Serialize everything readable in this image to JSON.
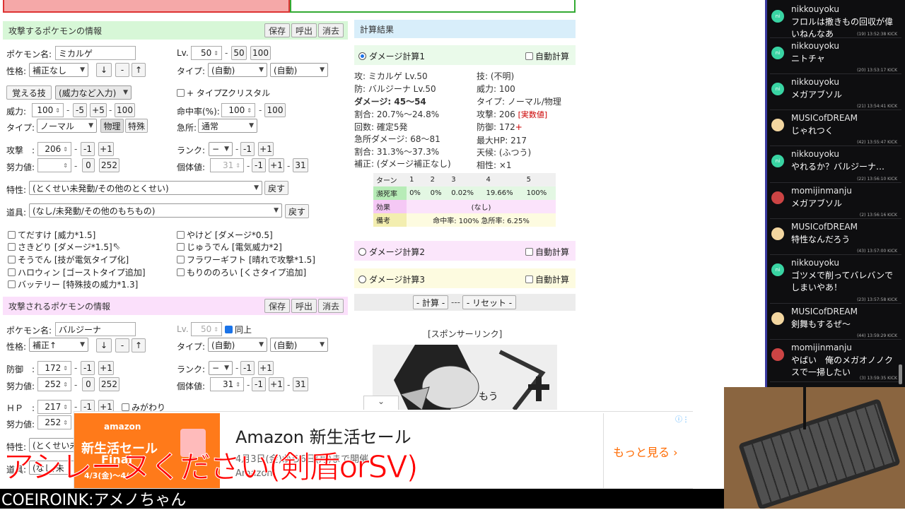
{
  "attacker": {
    "header": "攻撃するポケモンの情報",
    "save": "保存",
    "load": "呼出",
    "clear": "消去",
    "name_label": "ポケモン名:",
    "name_value": "ミカルゲ",
    "lv_label": "Lv.",
    "lv_value": "50",
    "lv_btn_50": "50",
    "lv_btn_100": "100",
    "nature_label": "性格:",
    "nature_value": "補正なし",
    "type_label": "タイプ:",
    "type1": "(自動)",
    "type2": "(自動)",
    "learn_btn": "覚える技",
    "move_select": "(威力など入力)",
    "tera_label": "+ タイプZクリスタル",
    "power_label": "威力:",
    "power_value": "100",
    "m5": "-5",
    "p5": "+5",
    "p100": "100",
    "acc_label": "命中率(%):",
    "acc_value": "100",
    "acc_100": "100",
    "mtype_label": "タイプ:",
    "mtype_value": "ノーマル",
    "physical": "物理",
    "special": "特殊",
    "crit_label": "急所:",
    "crit_value": "通常",
    "atk_label": "攻撃　:",
    "atk_value": "206",
    "minus1": "-1",
    "plus1": "+1",
    "rank_label": "ランク:",
    "rank_value": "−",
    "ev_label": "努力値:",
    "ev_value": "",
    "ev_0": "0",
    "ev_252": "252",
    "iv_label": "個体値:",
    "iv_value": "31",
    "iv_31": "31",
    "ability_label": "特性:",
    "ability_value": "(とくせい未発動/その他のとくせい)",
    "revert": "戻す",
    "item_label": "道具:",
    "item_value": "(なし/未発動/その他のもちもの)",
    "checks_left": [
      "てだすけ [威力*1.5]",
      "さきどり [ダメージ*1.5]",
      "そうでん [技が電気タイプ化]",
      "ハロウィン [ゴーストタイプ追加]",
      "バッテリー [特殊技の威力*1.3]"
    ],
    "checks_right": [
      "やけど [ダメージ*0.5]",
      "じゅうでん [電気威力*2]",
      "フラワーギフト [晴れで攻撃*1.5]",
      "もりののろい [くさタイプ追加]"
    ]
  },
  "defender": {
    "header": "攻撃されるポケモンの情報",
    "save": "保存",
    "load": "呼出",
    "clear": "消去",
    "name_label": "ポケモン名:",
    "name_value": "バルジーナ",
    "lv_label": "Lv.",
    "lv_value": "50",
    "same_label": "同上",
    "nature_label": "性格:",
    "nature_value": "補正↑",
    "type_label": "タイプ:",
    "type1": "(自動)",
    "type2": "(自動)",
    "def_label": "防御　:",
    "def_value": "172",
    "rank_label": "ランク:",
    "rank_value": "−",
    "ev_label": "努力値:",
    "ev_value": "252",
    "ev_0": "0",
    "ev_252": "252",
    "iv_label": "個体値:",
    "iv_value": "31",
    "iv_31": "31",
    "hp_label": "ＨＰ　:",
    "hp_value": "217",
    "mega_label": "みがわり",
    "hp_ev_label": "努力値:",
    "hp_ev_value": "252",
    "ability_label": "特性:",
    "ability_value": "(とくせい未",
    "item_label": "道具:",
    "item_value": "(なし/未"
  },
  "results": {
    "header": "計算結果",
    "calc1": "ダメージ計算1",
    "calc2": "ダメージ計算2",
    "calc3": "ダメージ計算3",
    "auto": "自動計算",
    "left": [
      "攻: ミカルゲ Lv.50",
      "防: バルジーナ Lv.50",
      "ダメージ: 45〜54",
      "割合: 20.7%〜24.8%",
      "回数: 確定5発",
      "急所ダメージ: 68〜81",
      "割合: 31.3%〜37.3%",
      "補正: (ダメージ補正なし)"
    ],
    "right": [
      "技: (不明)",
      "威力: 100",
      "タイプ: ノーマル/物理",
      "攻撃: 206",
      "防御: 172",
      "最大HP: 217",
      "天候: (ふつう)",
      "相性: ×1"
    ],
    "real_value": "[実数値]",
    "plus_mark": "+",
    "table_turn_label": "ターン",
    "turns": [
      "1",
      "2",
      "3",
      "4",
      "5"
    ],
    "dying_label": "瀕死率",
    "dying": [
      "0%",
      "0%",
      "0.02%",
      "19.66%",
      "100%"
    ],
    "effect_label": "効果",
    "effect_value": "(なし)",
    "note_label": "備考",
    "note_value": "命中率: 100% 急所率: 6.25%",
    "calc_btn": "- 計算 -",
    "sep": "---",
    "reset_btn": "- リセット -",
    "sponsor": "[スポンサーリンク]"
  },
  "ad": {
    "brand": "amazon",
    "img_line1": "新生活セール",
    "img_line2": "Final",
    "img_line3": "4/3(金)〜4/",
    "title": "Amazon 新生活セール",
    "subtitle": "4月3日(金)から6日(月)まで開催",
    "sub2": "Amazon",
    "cta": "もっと見る",
    "cta_icon": "chevron-right-icon"
  },
  "overlay": {
    "caption": "アシレーヌください(剣盾orSV)",
    "voice": "COEIROINK:アメノちゃん"
  },
  "chat": [
    {
      "user": "nikkouyoku",
      "text": "フロルは撒きもの回収が偉いねんなあ",
      "meta": "(19) 13:52:38 KICK",
      "avatar": "nikkouyoku"
    },
    {
      "user": "nikkouyoku",
      "text": "ニトチャ",
      "meta": "(20) 13:53:17 KICK",
      "avatar": "nikkouyoku"
    },
    {
      "user": "nikkouyoku",
      "text": "メガアブソル",
      "meta": "(21) 13:54:41 KICK",
      "avatar": "nikkouyoku"
    },
    {
      "user": "MUSICofDREAM",
      "text": "じゃれつく",
      "meta": "(42) 13:55:47 KICK",
      "avatar": "MUSICofDREAM"
    },
    {
      "user": "nikkouyoku",
      "text": "やれるか？バルジーナ…",
      "meta": "(22) 13:56:10 KICK",
      "avatar": "nikkouyoku"
    },
    {
      "user": "momijinmanju",
      "text": "メガアブソル",
      "meta": "(2) 13:56:16 KICK",
      "avatar": "momijinmanju"
    },
    {
      "user": "MUSICofDREAM",
      "text": "特性なんだろう",
      "meta": "(43) 13:57:00 KICK",
      "avatar": "MUSICofDREAM"
    },
    {
      "user": "nikkouyoku",
      "text": "ゴツメで削ってバレバンでしまいやあ！",
      "meta": "(23) 13:57:58 KICK",
      "avatar": "nikkouyoku"
    },
    {
      "user": "MUSICofDREAM",
      "text": "剣舞もするぜ〜",
      "meta": "(44) 13:59:29 KICK",
      "avatar": "MUSICofDREAM"
    },
    {
      "user": "momijinmanju",
      "text": "やばい　俺のメガオノノクスで一掃したい",
      "meta": "(3) 13:59:35 KICK",
      "avatar": "momijinmanju"
    }
  ],
  "colors": {
    "attacker_header": "#d7f7d7",
    "defender_header": "#fbe0fb",
    "result_header": "#d8eefa",
    "caption": "#ff0000"
  }
}
